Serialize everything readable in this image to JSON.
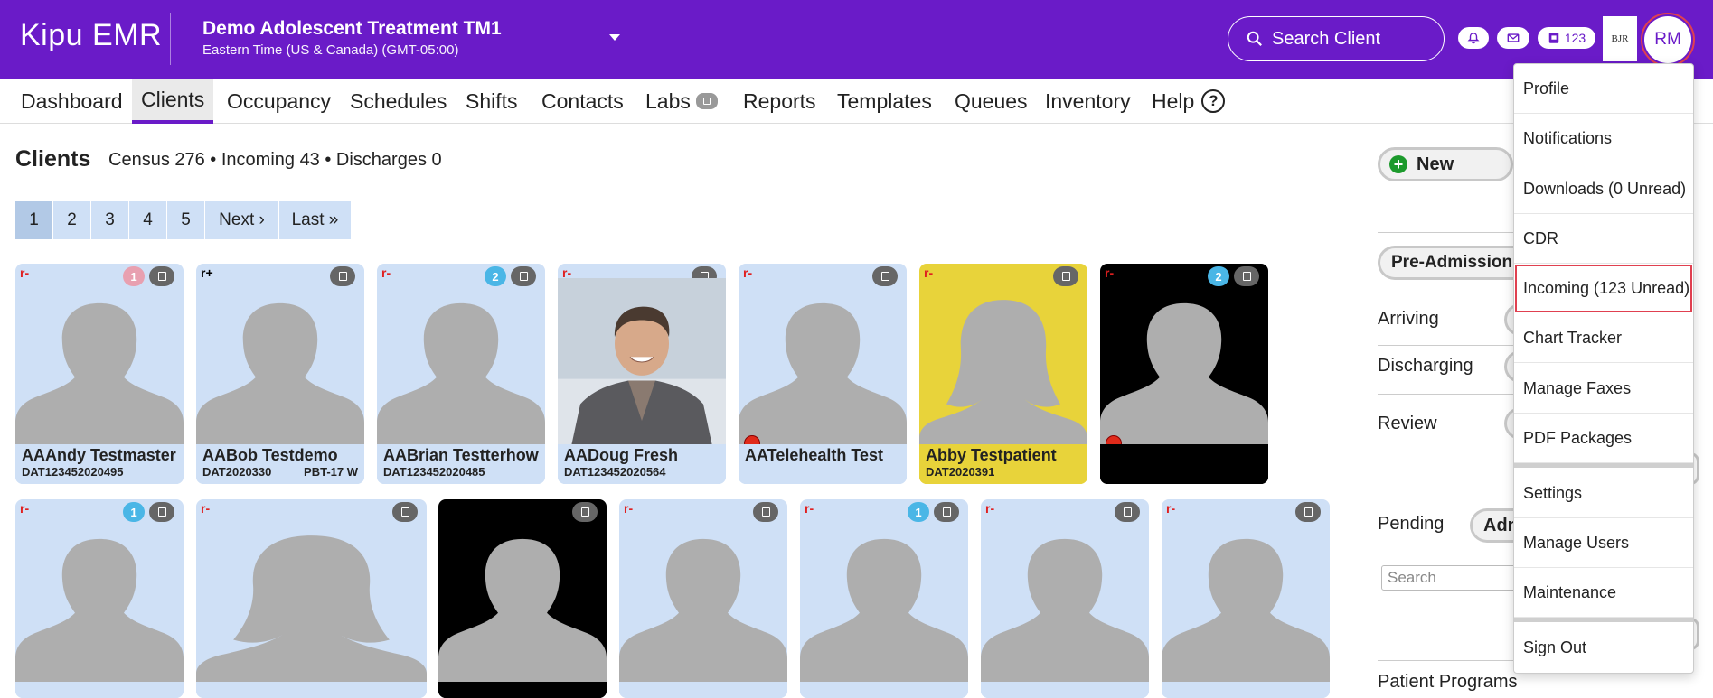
{
  "header": {
    "logo_left": "Kipu",
    "logo_right": "EMR",
    "facility_name": "Demo Adolescent Treatment TM1",
    "timezone": "Eastern Time (US & Canada) (GMT-05:00)",
    "search_label": "Search Client",
    "inbox_count": "123",
    "user_initials": "RM",
    "org_logo_text": "BJR"
  },
  "nav": {
    "items": [
      "Dashboard",
      "Clients",
      "Occupancy",
      "Schedules",
      "Shifts",
      "Contacts",
      "Labs",
      "Reports",
      "Templates",
      "Queues",
      "Inventory",
      "Help"
    ],
    "active": "Clients",
    "help_glyph": "?"
  },
  "clients": {
    "title": "Clients",
    "census": "Census 276 • Incoming 43 • Discharges 0",
    "pager": [
      "1",
      "2",
      "3",
      "4",
      "5",
      "Next ›",
      "Last »"
    ],
    "row1": [
      {
        "marker": "r-",
        "count": "1",
        "count_color": "#e8a0b0",
        "name": "AAAndy Testmaster",
        "id": "DAT123452020495",
        "extra": "",
        "bg": "light"
      },
      {
        "marker": "r+",
        "count": "",
        "name": "AABob Testdemo",
        "id": "DAT2020330",
        "extra": "PBT-17 W",
        "bg": "light"
      },
      {
        "marker": "r-",
        "count": "2",
        "count_color": "#4ab6e6",
        "name": "AABrian Testterhowtingttttt",
        "id": "DAT123452020485",
        "extra": "",
        "bg": "light"
      },
      {
        "marker": "r-",
        "count": "",
        "name": "AADoug Fresh",
        "id": "DAT123452020564",
        "extra": "",
        "bg": "photo"
      },
      {
        "marker": "r-",
        "count": "",
        "name": "AATelehealth Test",
        "id": "",
        "extra": "",
        "bg": "light",
        "red_dot": true
      },
      {
        "marker": "r-",
        "count": "",
        "name": "Abby Testpatient",
        "id": "DAT2020391",
        "extra": "",
        "bg": "yellow"
      },
      {
        "marker": "r-",
        "count": "2",
        "count_color": "#4ab6e6",
        "name": "",
        "id": "",
        "extra": "",
        "bg": "dark",
        "red_dot": true
      }
    ],
    "row2": [
      {
        "marker": "r-",
        "count": "1",
        "count_color": "#4ab6e6",
        "bg": "light"
      },
      {
        "marker": "r-",
        "count": "",
        "bg": "light"
      },
      {
        "marker": "",
        "count": "",
        "bg": "dark"
      },
      {
        "marker": "r-",
        "count": "",
        "bg": "light"
      },
      {
        "marker": "r-",
        "count": "1",
        "count_color": "#4ab6e6",
        "bg": "light"
      },
      {
        "marker": "r-",
        "count": "",
        "bg": "light"
      },
      {
        "marker": "r-",
        "count": "",
        "bg": "light"
      }
    ]
  },
  "sidebar": {
    "new_label": "New",
    "pre_admission_label": "Pre-Admission",
    "arriving": "Arriving",
    "discharging": "Discharging",
    "review": "Review",
    "pending": "Pending",
    "pending_btn": "Adm",
    "search_placeholder": "Search",
    "bottom_label": "Patient Programs"
  },
  "user_menu": {
    "items": [
      "Profile",
      "Notifications",
      "Downloads (0 Unread)",
      "CDR",
      "Incoming (123 Unread)",
      "Chart Tracker",
      "Manage Faxes",
      "PDF Packages",
      "Settings",
      "Manage Users",
      "Maintenance",
      "Sign Out"
    ],
    "highlighted": "Incoming (123 Unread)"
  },
  "colors": {
    "brand": "#6a1bc8",
    "card_light": "#cfe0f6",
    "card_yellow": "#e8d33a",
    "highlight_outline": "#e04050"
  }
}
